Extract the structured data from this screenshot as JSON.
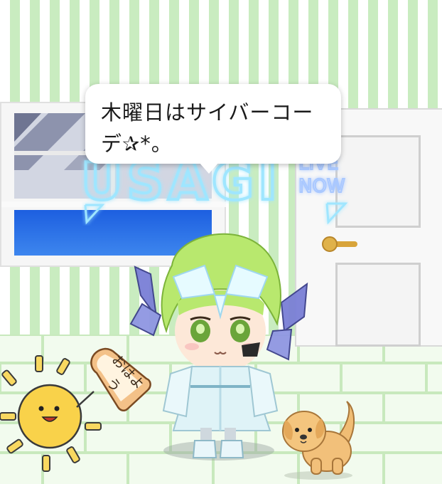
{
  "scene": {
    "speech_bubble": {
      "text": "木曜日はサイバーコーデ✰*。"
    },
    "neon_sign": {
      "main": "USAGI",
      "side_line1": "LIVE",
      "side_line2": "NOW"
    },
    "toast_label": "おはよう"
  },
  "icons": [
    "sun-character-icon",
    "toast-icon",
    "puppy-icon",
    "avatar-character"
  ],
  "colors": {
    "stripe_green": "#c9ecc0",
    "window_glass": "#2f74e8",
    "door_knob": "#d8a43a",
    "hair_green": "#b6e86a"
  }
}
